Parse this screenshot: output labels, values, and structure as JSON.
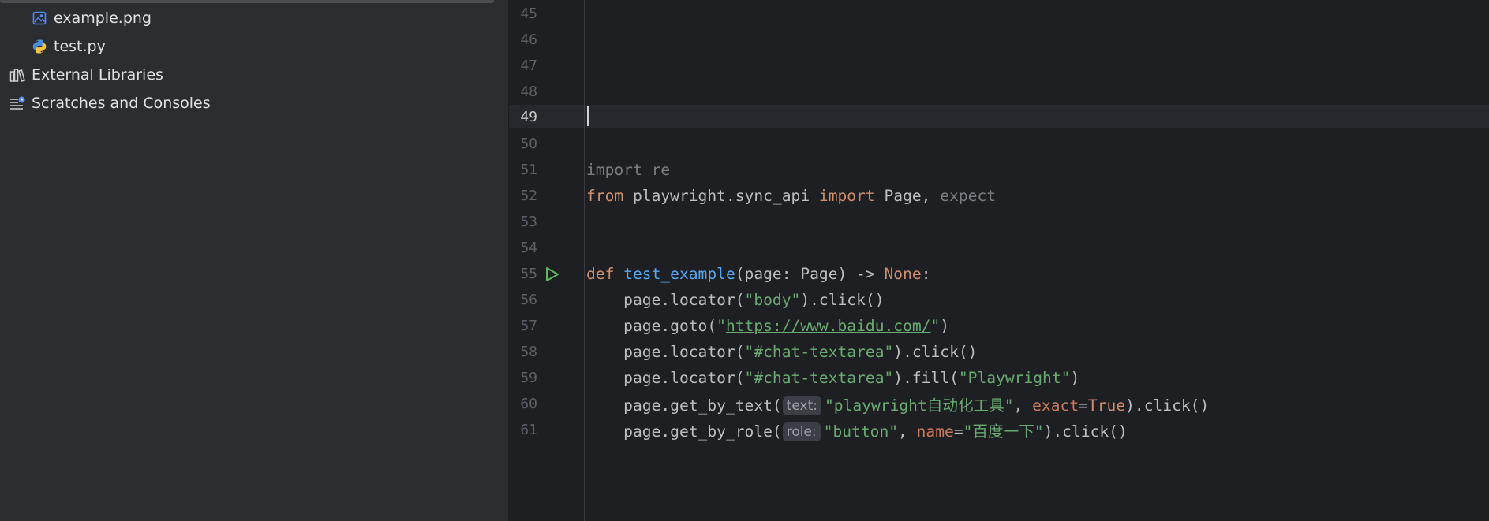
{
  "sidebar": {
    "items": [
      {
        "label": "example.png",
        "icon": "image-file-icon"
      },
      {
        "label": "test.py",
        "icon": "python-file-icon"
      },
      {
        "label": "External Libraries",
        "icon": "libraries-icon"
      },
      {
        "label": "Scratches and Consoles",
        "icon": "scratches-icon"
      }
    ]
  },
  "editor": {
    "active_line": 49,
    "line_numbers": [
      "45",
      "46",
      "47",
      "48",
      "49",
      "50",
      "51",
      "52",
      "53",
      "54",
      "55",
      "56",
      "57",
      "58",
      "59",
      "60",
      "61"
    ],
    "code": {
      "l51": {
        "kw1": "import",
        "mod": " re"
      },
      "l52": {
        "kw1": "from",
        "mod": " playwright.sync_api ",
        "kw2": "import",
        "names": " Page, ",
        "unused": "expect"
      },
      "l55": {
        "kw1": "def",
        "space": " ",
        "fn": "test_example",
        "params": "(page: Page) -> ",
        "none": "None",
        "colon": ":"
      },
      "l56": {
        "pre": "    page.locator(",
        "s1": "\"body\"",
        "post": ").click()"
      },
      "l57": {
        "pre": "    page.goto(",
        "q1": "\"",
        "url": "https://www.baidu.com/",
        "q2": "\"",
        "post": ")"
      },
      "l58": {
        "pre": "    page.locator(",
        "s1": "\"#chat-textarea\"",
        "post": ").click()"
      },
      "l59": {
        "pre": "    page.locator(",
        "s1": "\"#chat-textarea\"",
        "mid": ").fill(",
        "s2": "\"Playwright\"",
        "post": ")"
      },
      "l60": {
        "pre": "    page.get_by_text(",
        "hint": "text:",
        "s1a": "\"playwright",
        "s1cjk": "自动化工具",
        "s1b": "\"",
        "sep": ", ",
        "kwarg": "exact",
        "eq": "=",
        "val": "True",
        "post": ").click()"
      },
      "l61": {
        "pre": "    page.get_by_role(",
        "hint": "role:",
        "s1": "\"button\"",
        "sep": ", ",
        "kwarg": "name",
        "eq": "=",
        "s2a": "\"",
        "s2cjk": "百度一下",
        "s2b": "\"",
        "post": ").click()"
      }
    }
  },
  "colors": {
    "keyword": "#cf8e6d",
    "function": "#56a8f5",
    "string": "#6aab73",
    "kwarg": "#c77a5b",
    "unused": "#7a7e85",
    "run_gutter": "#5fb85f"
  }
}
